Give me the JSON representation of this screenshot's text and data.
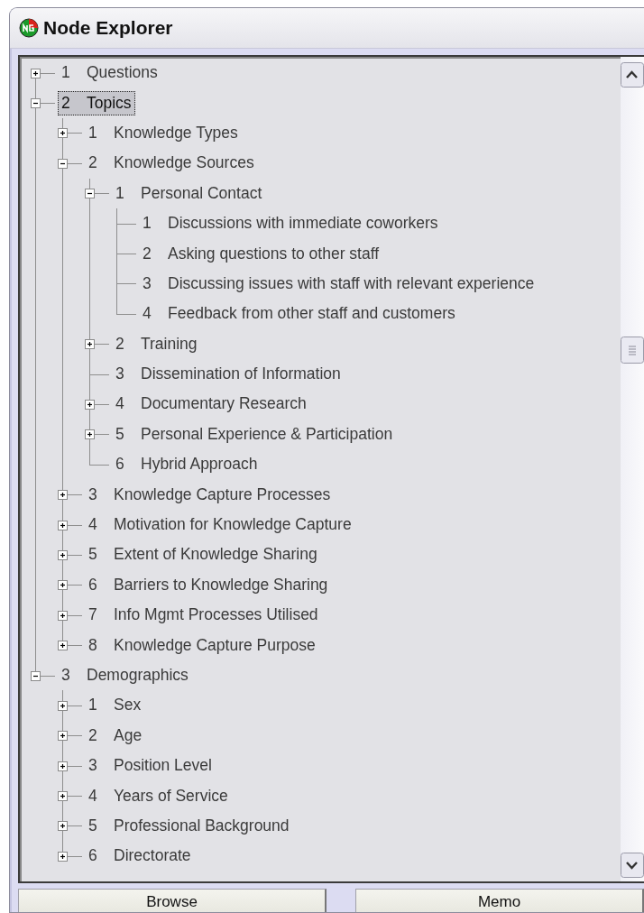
{
  "window": {
    "title": "Node Explorer"
  },
  "tree": [
    {
      "num": "1",
      "label": "Questions",
      "kind": "branch",
      "expanded": false,
      "selected": false
    },
    {
      "num": "2",
      "label": "Topics",
      "kind": "branch",
      "expanded": true,
      "selected": true,
      "children": [
        {
          "num": "1",
          "label": "Knowledge Types",
          "kind": "branch",
          "expanded": false,
          "selected": false
        },
        {
          "num": "2",
          "label": "Knowledge Sources",
          "kind": "branch",
          "expanded": true,
          "selected": false,
          "children": [
            {
              "num": "1",
              "label": "Personal Contact",
              "kind": "branch",
              "expanded": true,
              "selected": false,
              "children": [
                {
                  "num": "1",
                  "label": "Discussions with immediate coworkers",
                  "kind": "leaf",
                  "selected": false
                },
                {
                  "num": "2",
                  "label": "Asking questions to other staff",
                  "kind": "leaf",
                  "selected": false
                },
                {
                  "num": "3",
                  "label": "Discussing issues with staff with relevant experience",
                  "kind": "leaf",
                  "selected": false
                },
                {
                  "num": "4",
                  "label": "Feedback from other staff and customers",
                  "kind": "leaf",
                  "selected": false
                }
              ]
            },
            {
              "num": "2",
              "label": "Training",
              "kind": "branch",
              "expanded": false,
              "selected": false
            },
            {
              "num": "3",
              "label": "Dissemination of Information",
              "kind": "leaf",
              "selected": false
            },
            {
              "num": "4",
              "label": "Documentary Research",
              "kind": "branch",
              "expanded": false,
              "selected": false
            },
            {
              "num": "5",
              "label": "Personal Experience & Participation",
              "kind": "branch",
              "expanded": false,
              "selected": false
            },
            {
              "num": "6",
              "label": "Hybrid Approach",
              "kind": "leaf",
              "selected": false
            }
          ]
        },
        {
          "num": "3",
          "label": "Knowledge Capture Processes",
          "kind": "branch",
          "expanded": false,
          "selected": false
        },
        {
          "num": "4",
          "label": "Motivation for Knowledge Capture",
          "kind": "branch",
          "expanded": false,
          "selected": false
        },
        {
          "num": "5",
          "label": "Extent of Knowledge Sharing",
          "kind": "branch",
          "expanded": false,
          "selected": false
        },
        {
          "num": "6",
          "label": "Barriers to Knowledge Sharing",
          "kind": "branch",
          "expanded": false,
          "selected": false
        },
        {
          "num": "7",
          "label": "Info Mgmt Processes Utilised",
          "kind": "branch",
          "expanded": false,
          "selected": false
        },
        {
          "num": "8",
          "label": "Knowledge Capture Purpose",
          "kind": "branch",
          "expanded": false,
          "selected": false
        }
      ]
    },
    {
      "num": "3",
      "label": "Demographics",
      "kind": "branch",
      "expanded": true,
      "selected": false,
      "children": [
        {
          "num": "1",
          "label": "Sex",
          "kind": "branch",
          "expanded": false,
          "selected": false
        },
        {
          "num": "2",
          "label": "Age",
          "kind": "branch",
          "expanded": false,
          "selected": false
        },
        {
          "num": "3",
          "label": "Position Level",
          "kind": "branch",
          "expanded": false,
          "selected": false
        },
        {
          "num": "4",
          "label": "Years of Service",
          "kind": "branch",
          "expanded": false,
          "selected": false
        },
        {
          "num": "5",
          "label": "Professional Background",
          "kind": "branch",
          "expanded": false,
          "selected": false
        },
        {
          "num": "6",
          "label": "Directorate",
          "kind": "branch",
          "expanded": false,
          "selected": false
        }
      ]
    }
  ],
  "buttons": [
    {
      "label": "Browse"
    },
    {
      "label": "Memo"
    }
  ]
}
